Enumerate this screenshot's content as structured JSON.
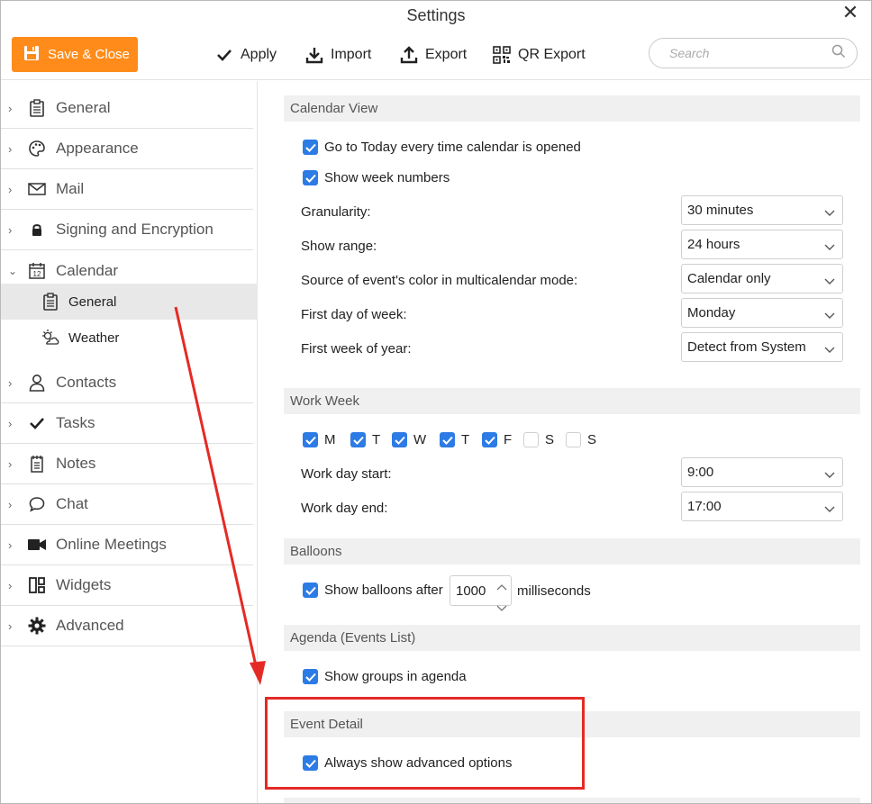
{
  "window": {
    "title": "Settings"
  },
  "toolbar": {
    "save_close": "Save & Close",
    "apply": "Apply",
    "import": "Import",
    "export": "Export",
    "qr_export": "QR Export",
    "search_placeholder": "Search"
  },
  "sidebar": {
    "items": [
      {
        "label": "General",
        "icon": "clipboard-icon"
      },
      {
        "label": "Appearance",
        "icon": "palette-icon"
      },
      {
        "label": "Mail",
        "icon": "envelope-icon"
      },
      {
        "label": "Signing and Encryption",
        "icon": "lock-icon"
      },
      {
        "label": "Calendar",
        "icon": "calendar-icon",
        "expanded": true,
        "children": [
          {
            "label": "General",
            "icon": "clipboard-icon",
            "selected": true
          },
          {
            "label": "Weather",
            "icon": "weather-icon"
          }
        ]
      },
      {
        "label": "Contacts",
        "icon": "person-icon"
      },
      {
        "label": "Tasks",
        "icon": "checkmark-icon"
      },
      {
        "label": "Notes",
        "icon": "notepad-icon"
      },
      {
        "label": "Chat",
        "icon": "speech-bubble-icon"
      },
      {
        "label": "Online Meetings",
        "icon": "video-camera-icon"
      },
      {
        "label": "Widgets",
        "icon": "widgets-icon"
      },
      {
        "label": "Advanced",
        "icon": "gear-icon"
      }
    ]
  },
  "calendar_view": {
    "header": "Calendar View",
    "go_to_today": {
      "label": "Go to Today every time calendar is opened",
      "checked": true
    },
    "show_week_numbers": {
      "label": "Show week numbers",
      "checked": true
    },
    "granularity": {
      "label": "Granularity:",
      "value": "30 minutes"
    },
    "show_range": {
      "label": "Show range:",
      "value": "24 hours"
    },
    "color_source": {
      "label": "Source of event's color in multicalendar mode:",
      "value": "Calendar only"
    },
    "first_day": {
      "label": "First day of week:",
      "value": "Monday"
    },
    "first_week": {
      "label": "First week of year:",
      "value": "Detect from System"
    }
  },
  "work_week": {
    "header": "Work Week",
    "days": [
      {
        "label": "M",
        "checked": true
      },
      {
        "label": "T",
        "checked": true
      },
      {
        "label": "W",
        "checked": true
      },
      {
        "label": "T",
        "checked": true
      },
      {
        "label": "F",
        "checked": true
      },
      {
        "label": "S",
        "checked": false
      },
      {
        "label": "S",
        "checked": false
      }
    ],
    "start": {
      "label": "Work day start:",
      "value": "9:00"
    },
    "end": {
      "label": "Work day end:",
      "value": "17:00"
    }
  },
  "balloons": {
    "header": "Balloons",
    "show_after": {
      "label": "Show balloons after",
      "checked": true
    },
    "value": "1000",
    "unit": "milliseconds"
  },
  "agenda": {
    "header": "Agenda (Events List)",
    "show_groups": {
      "label": "Show groups in agenda",
      "checked": true
    }
  },
  "event_detail": {
    "header": "Event Detail",
    "always_advanced": {
      "label": "Always show advanced options",
      "checked": true
    }
  },
  "colors": {
    "accent_orange": "#ff8c1a",
    "checkbox_blue": "#2d7be5",
    "annotation_red": "#e52a25"
  }
}
